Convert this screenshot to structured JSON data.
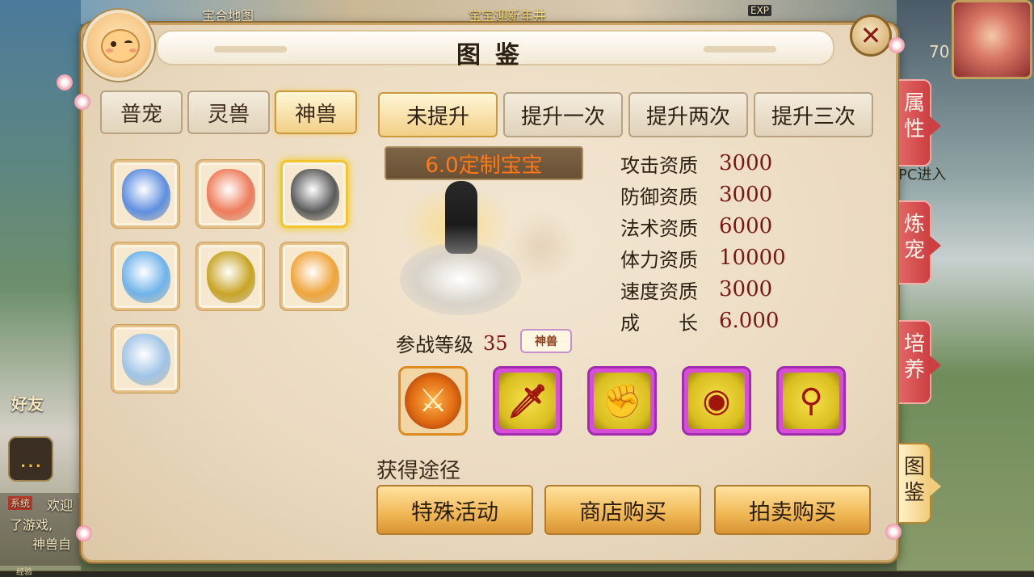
{
  "hud": {
    "map_label": "宝合地图",
    "top_banner": "宝宝迎新年井",
    "exp_badge": "EXP",
    "level_num": "70",
    "side_hint": "PC进入",
    "friend_label": "好友",
    "chat_prefix": "系统",
    "chat_line1": "欢迎",
    "chat_line2": "了游戏,",
    "chat_line3": "神兽自",
    "exp_bottom": "经验"
  },
  "panel": {
    "title": "图鉴",
    "close_icon": "close-x-icon"
  },
  "category_tabs": [
    {
      "label": "普宠",
      "active": false
    },
    {
      "label": "灵兽",
      "active": false
    },
    {
      "label": "神兽",
      "active": true
    }
  ],
  "pets": [
    {
      "name": "blue-armored-pet",
      "color": "#5f8fe0",
      "selected": false
    },
    {
      "name": "red-fire-pet",
      "color": "#ef7b5a",
      "selected": false
    },
    {
      "name": "dark-warrior-pet",
      "color": "#5b5b5b",
      "selected": true
    },
    {
      "name": "ice-maiden-pet",
      "color": "#6fb3ea",
      "selected": false
    },
    {
      "name": "gold-knight-pet",
      "color": "#c8a425",
      "selected": false
    },
    {
      "name": "flame-sprite-pet",
      "color": "#f0a43a",
      "selected": false
    },
    {
      "name": "white-sage-pet",
      "color": "#9fc3e6",
      "selected": false
    }
  ],
  "upgrade_tabs": [
    {
      "label": "未提升",
      "active": true
    },
    {
      "label": "提升一次",
      "active": false
    },
    {
      "label": "提升两次",
      "active": false
    },
    {
      "label": "提升三次",
      "active": false
    }
  ],
  "pet_name": "6.0定制宝宝",
  "stats": [
    {
      "label": "攻击资质",
      "value": "3000"
    },
    {
      "label": "防御资质",
      "value": "3000"
    },
    {
      "label": "法术资质",
      "value": "6000"
    },
    {
      "label": "体力资质",
      "value": "10000"
    },
    {
      "label": "速度资质",
      "value": "3000"
    },
    {
      "label": "成　　长",
      "value": "6.000"
    }
  ],
  "battle_level": {
    "label": "参战等级",
    "value": "35",
    "tag": "神兽"
  },
  "skills": [
    {
      "name": "fire-slash-skill-icon",
      "glyph": "⚔",
      "style": "gold"
    },
    {
      "name": "sword-skill-icon",
      "glyph": "🗡",
      "style": "purple"
    },
    {
      "name": "arm-strength-skill-icon",
      "glyph": "✊",
      "style": "purple"
    },
    {
      "name": "eye-skill-icon",
      "glyph": "◉",
      "style": "purple"
    },
    {
      "name": "person-skill-icon",
      "glyph": "⚲",
      "style": "purple"
    }
  ],
  "obtain": {
    "title": "获得途径",
    "buttons": [
      "特殊活动",
      "商店购买",
      "拍卖购买"
    ]
  },
  "side_tabs": [
    {
      "label": "属性",
      "active": false
    },
    {
      "label": "炼宠",
      "active": false
    },
    {
      "label": "培养",
      "active": false
    },
    {
      "label": "图鉴",
      "active": true
    }
  ]
}
